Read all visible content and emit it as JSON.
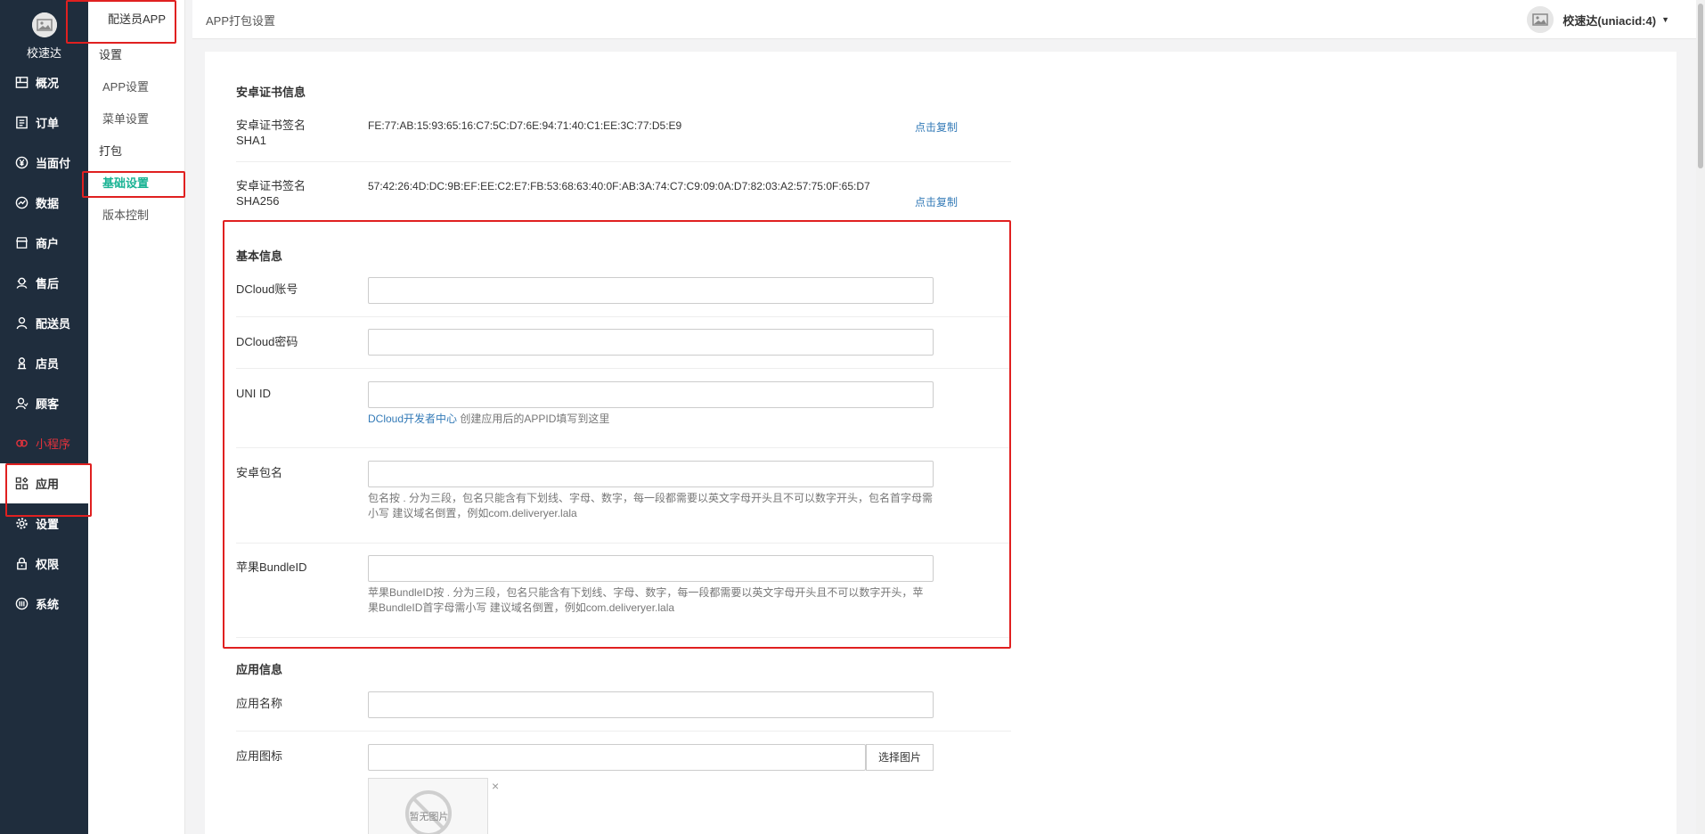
{
  "brand": {
    "name": "校速达"
  },
  "sidebar": {
    "items": [
      {
        "label": "概况",
        "icon": "overview-icon"
      },
      {
        "label": "订单",
        "icon": "order-icon"
      },
      {
        "label": "当面付",
        "icon": "yuan-icon"
      },
      {
        "label": "数据",
        "icon": "chart-icon"
      },
      {
        "label": "商户",
        "icon": "store-icon"
      },
      {
        "label": "售后",
        "icon": "aftersale-icon"
      },
      {
        "label": "配送员",
        "icon": "courier-icon"
      },
      {
        "label": "店员",
        "icon": "clerk-icon"
      },
      {
        "label": "顾客",
        "icon": "customer-icon"
      },
      {
        "label": "小程序",
        "icon": "miniprogram-icon"
      },
      {
        "label": "应用",
        "icon": "apps-icon"
      },
      {
        "label": "设置",
        "icon": "gear-icon"
      },
      {
        "label": "权限",
        "icon": "lock-icon"
      },
      {
        "label": "系统",
        "icon": "system-icon"
      }
    ]
  },
  "subnav": {
    "title": "配送员APP",
    "group1": "设置",
    "app_settings": "APP设置",
    "menu_settings": "菜单设置",
    "group2": "打包",
    "basic_settings": "基础设置",
    "version_control": "版本控制"
  },
  "header": {
    "page_title": "APP打包设置",
    "user": "校速达(uniacid:4)"
  },
  "cert": {
    "section_title": "安卓证书信息",
    "sha1_label_1": "安卓证书签名",
    "sha1_label_2": "SHA1",
    "sha1_value": "FE:77:AB:15:93:65:16:C7:5C:D7:6E:94:71:40:C1:EE:3C:77:D5:E9",
    "sha256_label_1": "安卓证书签名",
    "sha256_label_2": "SHA256",
    "sha256_value": "57:42:26:4D:DC:9B:EF:EE:C2:E7:FB:53:68:63:40:0F:AB:3A:74:C7:C9:09:0A:D7:82:03:A2:57:75:0F:65:D7",
    "copy_label": "点击复制"
  },
  "basic": {
    "section_title": "基本信息",
    "dcloud_account_label": "DCloud账号",
    "dcloud_account_value": "",
    "dcloud_password_label": "DCloud密码",
    "dcloud_password_value": "",
    "uni_id_label": "UNI ID",
    "uni_id_value": "",
    "uni_id_help_link": "DCloud开发者中心",
    "uni_id_help_text": " 创建应用后的APPID填写到这里",
    "android_pkg_label": "安卓包名",
    "android_pkg_value": "",
    "android_pkg_help": "包名按 . 分为三段，包名只能含有下划线、字母、数字，每一段都需要以英文字母开头且不可以数字开头，包名首字母需小写 建议域名倒置，例如com.deliveryer.lala",
    "ios_bundle_label": "苹果BundleID",
    "ios_bundle_value": "",
    "ios_bundle_help": "苹果BundleID按 . 分为三段，包名只能含有下划线、字母、数字，每一段都需要以英文字母开头且不可以数字开头，苹果BundleID首字母需小写 建议域名倒置，例如com.deliveryer.lala"
  },
  "app": {
    "section_title": "应用信息",
    "name_label": "应用名称",
    "name_value": "",
    "icon_label": "应用图标",
    "icon_value": "",
    "pick_button": "选择图片",
    "no_image": "暂无图片",
    "remove": "×"
  }
}
